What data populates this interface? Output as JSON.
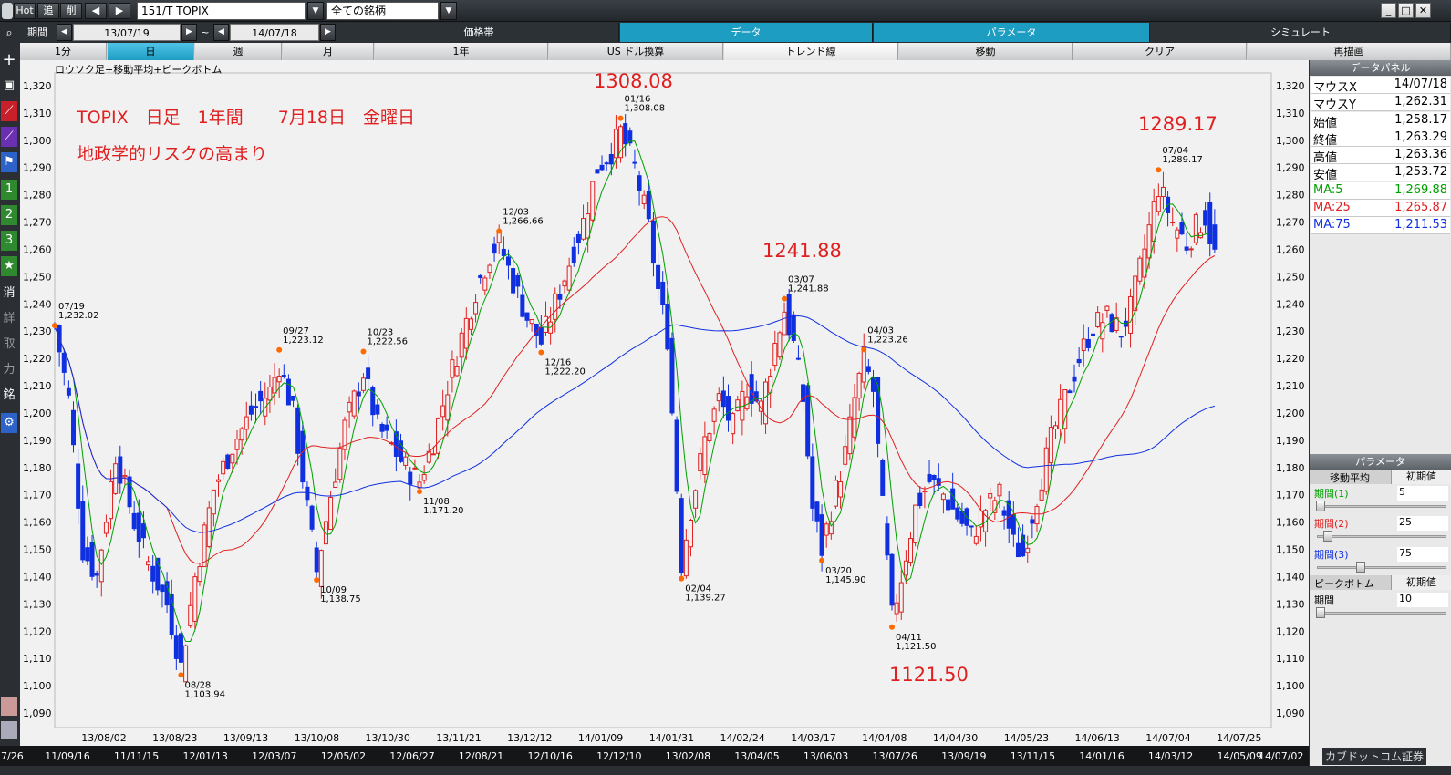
{
  "toolbar": {
    "hot": "Hot",
    "tsui": "追",
    "saku": "削",
    "symbol": "151/T TOPIX",
    "universe": "全ての銘柄"
  },
  "period": {
    "label": "期間",
    "from": "13/07/19",
    "tilde": "~",
    "to": "14/07/18",
    "tabs": [
      "価格帯",
      "データ",
      "パラメータ",
      "シミュレート"
    ]
  },
  "range_tabs": [
    "1分",
    "日",
    "週",
    "月",
    "1年",
    "US ドル換算",
    "トレンド線",
    "移動",
    "クリア",
    "再描画"
  ],
  "sidebar": [
    "消",
    "詳",
    "取",
    "力",
    "銘"
  ],
  "chart_data": {
    "type": "candlestick",
    "legend_text": "ロウソク足+移動平均+ピークボトム",
    "annotation_title": "TOPIX　日足　1年間　　7月18日　金曜日",
    "annotation_subtitle": "地政学的リスクの高まり",
    "big_labels": [
      "1308.08",
      "1241.88",
      "1289.17",
      "1121.50"
    ],
    "ylim": [
      1085,
      1325
    ],
    "y_ticks": [
      1090,
      1100,
      1110,
      1120,
      1130,
      1140,
      1150,
      1160,
      1170,
      1180,
      1190,
      1200,
      1210,
      1220,
      1230,
      1240,
      1250,
      1260,
      1270,
      1280,
      1290,
      1300,
      1310,
      1320
    ],
    "x_ticks": [
      "13/08/02",
      "13/08/23",
      "13/09/13",
      "13/10/08",
      "13/10/30",
      "13/11/21",
      "13/12/12",
      "14/01/09",
      "14/01/31",
      "14/02/24",
      "14/03/17",
      "14/04/08",
      "14/04/30",
      "14/05/23",
      "14/06/13",
      "14/07/04",
      "14/07/25"
    ],
    "x_ticks2": [
      "11/09/16",
      "11/11/15",
      "12/01/13",
      "12/03/07",
      "12/05/02",
      "12/06/27",
      "12/08/21",
      "12/10/16",
      "12/12/10",
      "13/02/08",
      "13/04/05",
      "13/06/03",
      "13/07/26",
      "13/09/19",
      "13/11/15",
      "14/01/16",
      "14/03/12",
      "14/05/09"
    ],
    "x_ticks2_edge": [
      "7/26",
      "14/07/02"
    ],
    "peaks": [
      {
        "date": "07/19",
        "value": "1,232.02",
        "i": 0,
        "y": 1232.02,
        "type": "peak"
      },
      {
        "date": "08/28",
        "value": "1,103.94",
        "i": 27,
        "y": 1103.94,
        "type": "bottom"
      },
      {
        "date": "09/27",
        "value": "1,223.12",
        "i": 48,
        "y": 1223.12,
        "type": "peak"
      },
      {
        "date": "10/09",
        "value": "1,138.75",
        "i": 56,
        "y": 1138.75,
        "type": "bottom"
      },
      {
        "date": "10/23",
        "value": "1,222.56",
        "i": 66,
        "y": 1222.56,
        "type": "peak"
      },
      {
        "date": "11/08",
        "value": "1,171.20",
        "i": 78,
        "y": 1171.2,
        "type": "bottom"
      },
      {
        "date": "12/03",
        "value": "1,266.66",
        "i": 95,
        "y": 1266.66,
        "type": "peak"
      },
      {
        "date": "12/16",
        "value": "1,222.20",
        "i": 104,
        "y": 1222.2,
        "type": "bottom"
      },
      {
        "date": "01/16",
        "value": "1,308.08",
        "i": 121,
        "y": 1308.08,
        "type": "peak"
      },
      {
        "date": "02/04",
        "value": "1,139.27",
        "i": 134,
        "y": 1139.27,
        "type": "bottom"
      },
      {
        "date": "03/07",
        "value": "1,241.88",
        "i": 156,
        "y": 1241.88,
        "type": "peak"
      },
      {
        "date": "03/20",
        "value": "1,145.90",
        "i": 164,
        "y": 1145.9,
        "type": "bottom"
      },
      {
        "date": "04/03",
        "value": "1,223.26",
        "i": 173,
        "y": 1223.26,
        "type": "peak"
      },
      {
        "date": "04/11",
        "value": "1,121.50",
        "i": 179,
        "y": 1121.5,
        "type": "bottom"
      },
      {
        "date": "07/04",
        "value": "1,289.17",
        "i": 236,
        "y": 1289.17,
        "type": "peak"
      }
    ],
    "anchors": [
      [
        0,
        1232
      ],
      [
        3,
        1205
      ],
      [
        6,
        1150
      ],
      [
        9,
        1140
      ],
      [
        13,
        1185
      ],
      [
        17,
        1160
      ],
      [
        20,
        1145
      ],
      [
        24,
        1130
      ],
      [
        27,
        1107
      ],
      [
        30,
        1140
      ],
      [
        34,
        1172
      ],
      [
        38,
        1188
      ],
      [
        42,
        1200
      ],
      [
        46,
        1208
      ],
      [
        48,
        1218
      ],
      [
        51,
        1200
      ],
      [
        54,
        1165
      ],
      [
        56,
        1142
      ],
      [
        59,
        1170
      ],
      [
        62,
        1195
      ],
      [
        66,
        1215
      ],
      [
        69,
        1195
      ],
      [
        72,
        1188
      ],
      [
        75,
        1180
      ],
      [
        78,
        1175
      ],
      [
        81,
        1190
      ],
      [
        84,
        1210
      ],
      [
        87,
        1228
      ],
      [
        90,
        1245
      ],
      [
        93,
        1258
      ],
      [
        95,
        1263
      ],
      [
        98,
        1248
      ],
      [
        101,
        1235
      ],
      [
        104,
        1226
      ],
      [
        107,
        1240
      ],
      [
        110,
        1255
      ],
      [
        113,
        1270
      ],
      [
        116,
        1290
      ],
      [
        119,
        1296
      ],
      [
        121,
        1303
      ],
      [
        124,
        1290
      ],
      [
        127,
        1268
      ],
      [
        129,
        1245
      ],
      [
        131,
        1228
      ],
      [
        134,
        1145
      ],
      [
        136,
        1165
      ],
      [
        139,
        1190
      ],
      [
        142,
        1205
      ],
      [
        145,
        1195
      ],
      [
        148,
        1210
      ],
      [
        151,
        1202
      ],
      [
        154,
        1225
      ],
      [
        156,
        1238
      ],
      [
        158,
        1225
      ],
      [
        160,
        1205
      ],
      [
        162,
        1165
      ],
      [
        164,
        1150
      ],
      [
        166,
        1165
      ],
      [
        169,
        1185
      ],
      [
        171,
        1205
      ],
      [
        173,
        1220
      ],
      [
        175,
        1208
      ],
      [
        177,
        1165
      ],
      [
        179,
        1125
      ],
      [
        181,
        1140
      ],
      [
        184,
        1165
      ],
      [
        187,
        1175
      ],
      [
        190,
        1170
      ],
      [
        193,
        1162
      ],
      [
        196,
        1155
      ],
      [
        199,
        1165
      ],
      [
        202,
        1170
      ],
      [
        205,
        1152
      ],
      [
        207,
        1148
      ],
      [
        210,
        1170
      ],
      [
        213,
        1190
      ],
      [
        216,
        1205
      ],
      [
        219,
        1220
      ],
      [
        222,
        1232
      ],
      [
        225,
        1235
      ],
      [
        228,
        1230
      ],
      [
        230,
        1238
      ],
      [
        233,
        1260
      ],
      [
        236,
        1283
      ],
      [
        239,
        1270
      ],
      [
        242,
        1262
      ],
      [
        244,
        1268
      ],
      [
        246,
        1272
      ],
      [
        248,
        1258
      ]
    ],
    "ma_lines": [
      {
        "name": "MA:5",
        "color": "#00a000"
      },
      {
        "name": "MA:25",
        "color": "#e02020"
      },
      {
        "name": "MA:75",
        "color": "#1030e0"
      }
    ]
  },
  "data_panel": {
    "title": "データパネル",
    "rows": [
      {
        "k": "マウスX",
        "v": "14/07/18"
      },
      {
        "k": "マウスY",
        "v": "1,262.31"
      },
      {
        "k": "始値",
        "v": "1,258.17"
      },
      {
        "k": "終値",
        "v": "1,263.29"
      },
      {
        "k": "高値",
        "v": "1,263.36"
      },
      {
        "k": "安値",
        "v": "1,253.72"
      }
    ],
    "ma_rows": [
      {
        "k": "MA:5",
        "v": "1,269.88",
        "color": "#00a000"
      },
      {
        "k": "MA:25",
        "v": "1,265.87",
        "color": "#e02020"
      },
      {
        "k": "MA:75",
        "v": "1,211.53",
        "color": "#1030e0"
      }
    ]
  },
  "param_panel": {
    "title": "パラメータ",
    "ma_header": "移動平均",
    "init_label": "初期値",
    "periods": [
      {
        "label": "期間(1)",
        "value": "5",
        "color": "#00a000",
        "pos": 0.0
      },
      {
        "label": "期間(2)",
        "value": "25",
        "color": "#e02020",
        "pos": 0.1
      },
      {
        "label": "期間(3)",
        "value": "75",
        "color": "#1030e0",
        "pos": 0.32
      }
    ],
    "pb_header": "ピークボトム",
    "pb_label": "期間",
    "pb_value": "10",
    "pb_pos": 0.0
  },
  "brand": "カブドットコム証券"
}
